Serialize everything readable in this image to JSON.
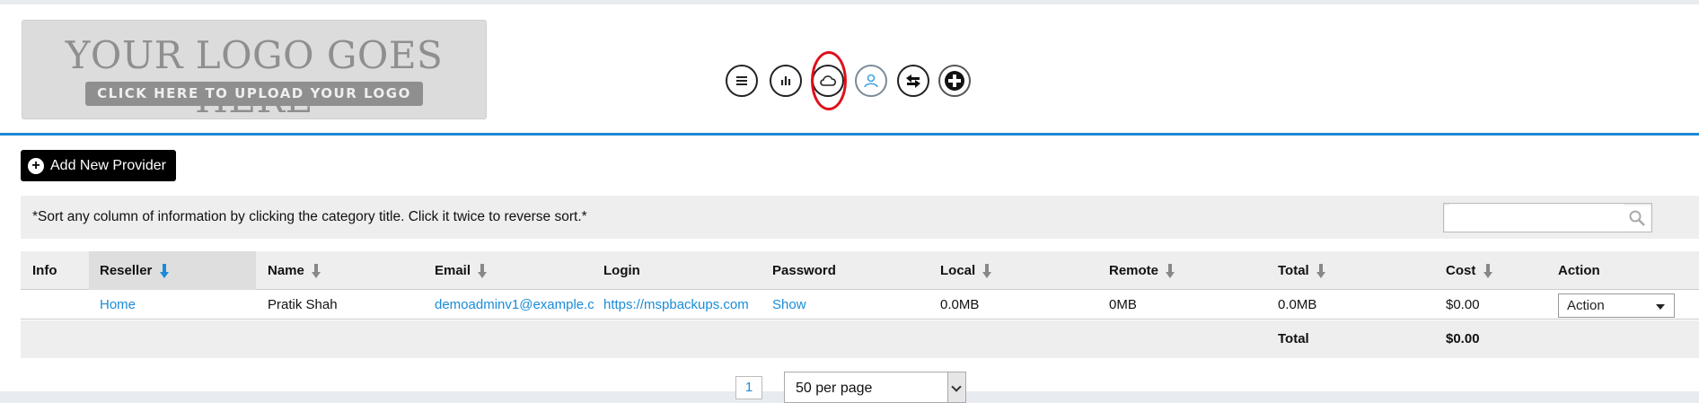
{
  "logo": {
    "line1": "YOUR LOGO GOES HERE",
    "line2": "CLICK HERE TO UPLOAD YOUR LOGO"
  },
  "nav_icons": [
    {
      "name": "menu-icon"
    },
    {
      "name": "bar-chart-icon"
    },
    {
      "name": "cloud-icon",
      "highlighted": true
    },
    {
      "name": "user-icon"
    },
    {
      "name": "swap-arrows-icon"
    },
    {
      "name": "plus-cross-icon"
    }
  ],
  "colors": {
    "accent": "#1e88d4",
    "link": "#1a8cd8",
    "highlight": "#e0101a"
  },
  "toolbar": {
    "add_label": "Add New Provider"
  },
  "sort_hint": "*Sort any column of information by clicking the category title. Click it twice to reverse sort.*",
  "search": {
    "value": "",
    "placeholder": ""
  },
  "table": {
    "headers": {
      "info": "Info",
      "reseller": "Reseller",
      "name": "Name",
      "email": "Email",
      "login": "Login",
      "password": "Password",
      "local": "Local",
      "remote": "Remote",
      "total": "Total",
      "cost": "Cost",
      "action": "Action"
    },
    "rows": [
      {
        "reseller": "Home",
        "name": "Pratik Shah",
        "email": "demoadminv1@example.c",
        "login": "https://mspbackups.com",
        "password": "Show",
        "local": "0.0MB",
        "remote": "0MB",
        "total": "0.0MB",
        "cost": "$0.00",
        "action": "Action"
      }
    ],
    "footer": {
      "total_label": "Total",
      "total_cost": "$0.00"
    }
  },
  "pagination": {
    "current_page": "1",
    "per_page": "50 per page"
  }
}
